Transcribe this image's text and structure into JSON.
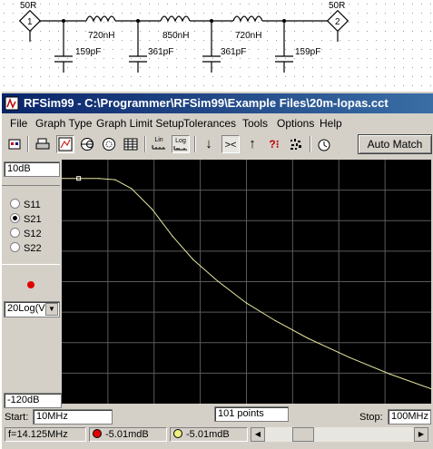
{
  "schematic": {
    "port1": {
      "impedance": "50R",
      "number": "1"
    },
    "port2": {
      "impedance": "50R",
      "number": "2"
    },
    "inductors": [
      "720nH",
      "850nH",
      "720nH"
    ],
    "capacitors": [
      "159pF",
      "361pF",
      "361pF",
      "159pF"
    ]
  },
  "window": {
    "title": "RFSim99 - C:\\Programmer\\RFSim99\\Example Files\\20m-lopas.cct"
  },
  "menu": [
    "File",
    "Graph Type",
    "Graph Limit Setup",
    "Tolerances",
    "Tools",
    "Options",
    "Help"
  ],
  "toolbar": {
    "auto_match_label": "Auto Match",
    "icons": [
      "component-icon",
      "print-icon",
      "graph-icon",
      "smith-chart-icon",
      "polar-icon",
      "table-icon",
      "lin-scale-icon",
      "log-scale-icon",
      "down-arrow-icon",
      "shrink-icon",
      "up-arrow-icon",
      "help-cursor-icon",
      "noise-icon",
      "timer-icon"
    ],
    "lin_label": "Lin",
    "log_label": "Log"
  },
  "graph": {
    "top_value": "10dB",
    "bottom_value": "-120dB",
    "params": [
      "S11",
      "S21",
      "S12",
      "S22"
    ],
    "selected_param": "S21",
    "format_select": "20Log(V",
    "trace_color": "#e8e6a0",
    "grid_color": "#5a5a5a"
  },
  "chart_data": {
    "type": "line",
    "series": [
      {
        "name": "S21",
        "x": [
          10,
          19,
          23,
          27,
          32,
          37,
          42,
          48,
          55,
          62,
          70,
          80,
          90,
          100
        ],
        "y": [
          0,
          0,
          -0.7,
          -5.4,
          -16.4,
          -30.8,
          -43.2,
          -54.7,
          -66.4,
          -75.8,
          -85.2,
          -95.3,
          -104.3,
          -112.1
        ]
      }
    ],
    "xlim": [
      10,
      100
    ],
    "ylim": [
      -120,
      10
    ],
    "x_divisions": 8,
    "y_divisions": 8,
    "grid": true
  },
  "bottom": {
    "start_label": "Start:",
    "start_value": "10MHz",
    "points_value": "101 points",
    "stop_label": "Stop:",
    "stop_value": "100MHz"
  },
  "status": {
    "freq": "f=14.125MHz",
    "marker1": "-5.01mdB",
    "marker2": "-5.01mdB",
    "marker1_color": "#e00000",
    "marker2_color": "#f0f080"
  }
}
